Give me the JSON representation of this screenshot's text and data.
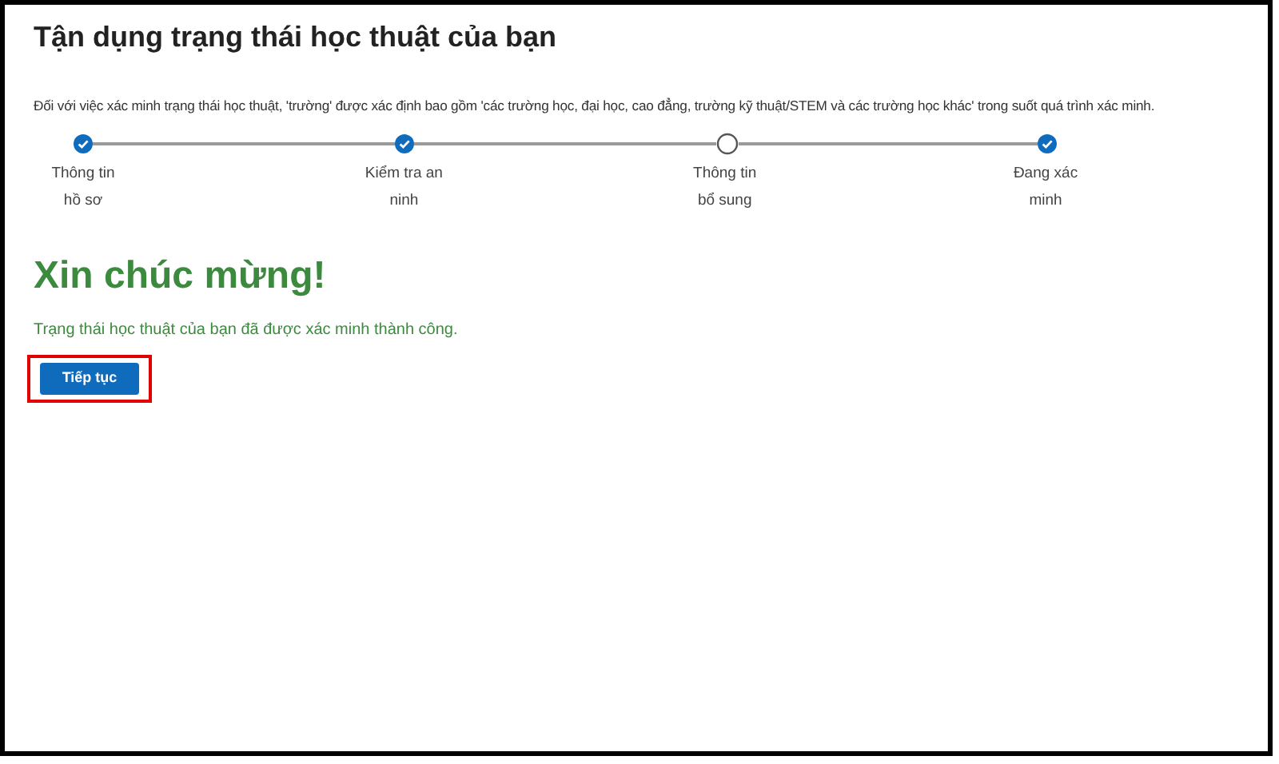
{
  "title": "Tận dụng trạng thái học thuật của bạn",
  "description": "Đối với việc xác minh trạng thái học thuật, 'trường' được xác định bao gồm 'các trường học, đại học, cao đẳng, trường kỹ thuật/STEM và các trường học khác' trong suốt quá trình xác minh.",
  "steps": [
    {
      "label": "Thông tin\nhồ sơ",
      "checked": true
    },
    {
      "label": "Kiểm tra an\nninh",
      "checked": true
    },
    {
      "label": "Thông tin\nbổ sung",
      "checked": false
    },
    {
      "label": "Đang xác\nminh",
      "checked": true
    }
  ],
  "heading": "Xin chúc mừng!",
  "message": "Trạng thái học thuật của bạn đã được xác minh thành công.",
  "button": {
    "label": "Tiếp tục",
    "highlighted": true
  }
}
